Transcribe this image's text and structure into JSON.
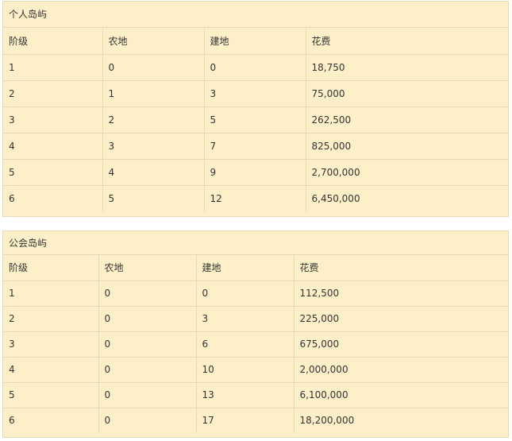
{
  "personal_island": {
    "title": "个人岛屿",
    "headers": [
      "阶级",
      "农地",
      "建地",
      "花费"
    ],
    "rows": [
      [
        "1",
        "0",
        "0",
        "18,750"
      ],
      [
        "2",
        "1",
        "3",
        "75,000"
      ],
      [
        "3",
        "2",
        "5",
        "262,500"
      ],
      [
        "4",
        "3",
        "7",
        "825,000"
      ],
      [
        "5",
        "4",
        "9",
        "2,700,000"
      ],
      [
        "6",
        "5",
        "12",
        "6,450,000"
      ]
    ]
  },
  "guild_island": {
    "title": "公会岛屿",
    "headers": [
      "阶级",
      "农地",
      "建地",
      "花费"
    ],
    "rows": [
      [
        "1",
        "0",
        "0",
        "112,500"
      ],
      [
        "2",
        "0",
        "3",
        "225,000"
      ],
      [
        "3",
        "0",
        "6",
        "675,000"
      ],
      [
        "4",
        "0",
        "10",
        "2,000,000"
      ],
      [
        "5",
        "0",
        "13",
        "6,100,000"
      ],
      [
        "6",
        "0",
        "17",
        "18,200,000"
      ]
    ]
  },
  "colors": {
    "panel_background": "#fdf0c9",
    "border": "#e6d9b3",
    "text": "#333333"
  }
}
